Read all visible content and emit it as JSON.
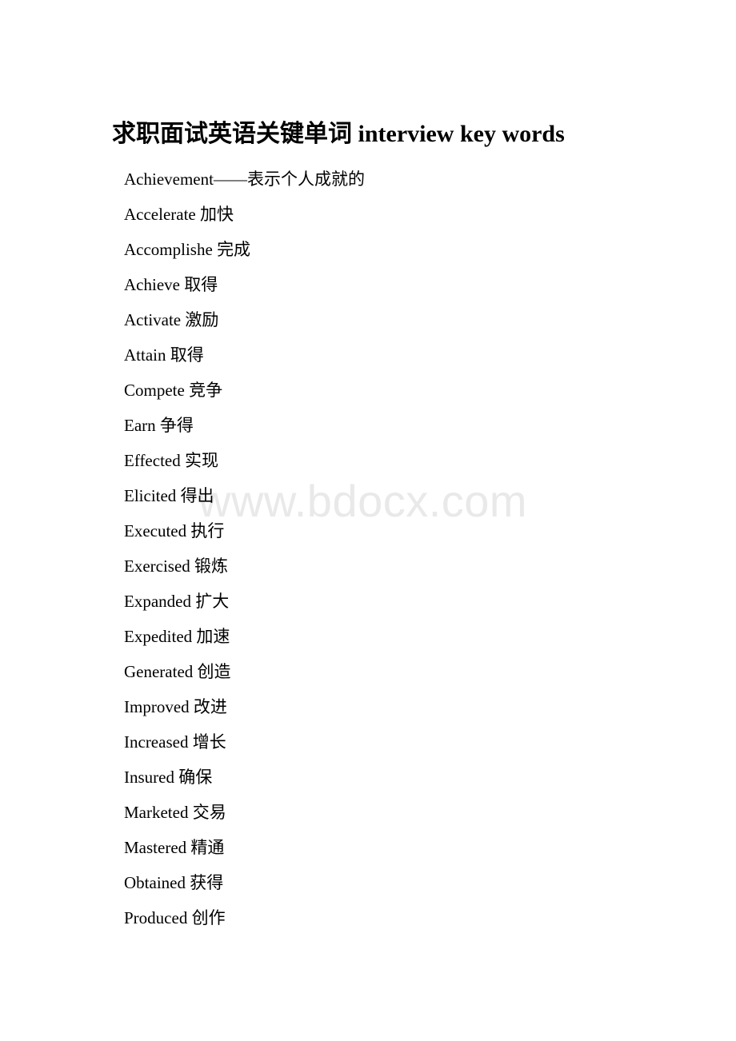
{
  "document": {
    "title": "求职面试英语关键单词 interview key words",
    "watermark": "www.bdocx.com",
    "watermark_color": "#e9e9e9",
    "background_color": "#ffffff",
    "text_color": "#000000",
    "entries": [
      {
        "term": "Achievement",
        "separator": "——",
        "gloss": "表示个人成就的"
      },
      {
        "term": "Accelerate",
        "separator": " ",
        "gloss": "加快"
      },
      {
        "term": "Accomplishe",
        "separator": " ",
        "gloss": "完成"
      },
      {
        "term": "Achieve",
        "separator": " ",
        "gloss": "取得"
      },
      {
        "term": "Activate",
        "separator": " ",
        "gloss": "激励"
      },
      {
        "term": "Attain",
        "separator": " ",
        "gloss": "取得"
      },
      {
        "term": "Compete",
        "separator": " ",
        "gloss": "竞争"
      },
      {
        "term": "Earn",
        "separator": " ",
        "gloss": "争得"
      },
      {
        "term": "Effected",
        "separator": " ",
        "gloss": "实现"
      },
      {
        "term": "Elicited",
        "separator": " ",
        "gloss": "得出"
      },
      {
        "term": "Executed",
        "separator": " ",
        "gloss": "执行"
      },
      {
        "term": "Exercised",
        "separator": " ",
        "gloss": "锻炼"
      },
      {
        "term": "Expanded",
        "separator": " ",
        "gloss": "扩大"
      },
      {
        "term": "Expedited",
        "separator": " ",
        "gloss": "加速"
      },
      {
        "term": "Generated",
        "separator": " ",
        "gloss": "创造"
      },
      {
        "term": "Improved",
        "separator": " ",
        "gloss": "改进"
      },
      {
        "term": "Increased",
        "separator": " ",
        "gloss": "增长"
      },
      {
        "term": "Insured",
        "separator": " ",
        "gloss": "确保"
      },
      {
        "term": "Marketed",
        "separator": " ",
        "gloss": "交易"
      },
      {
        "term": "Mastered",
        "separator": " ",
        "gloss": "精通"
      },
      {
        "term": "Obtained",
        "separator": " ",
        "gloss": "获得"
      },
      {
        "term": "Produced",
        "separator": " ",
        "gloss": "创作"
      }
    ]
  }
}
